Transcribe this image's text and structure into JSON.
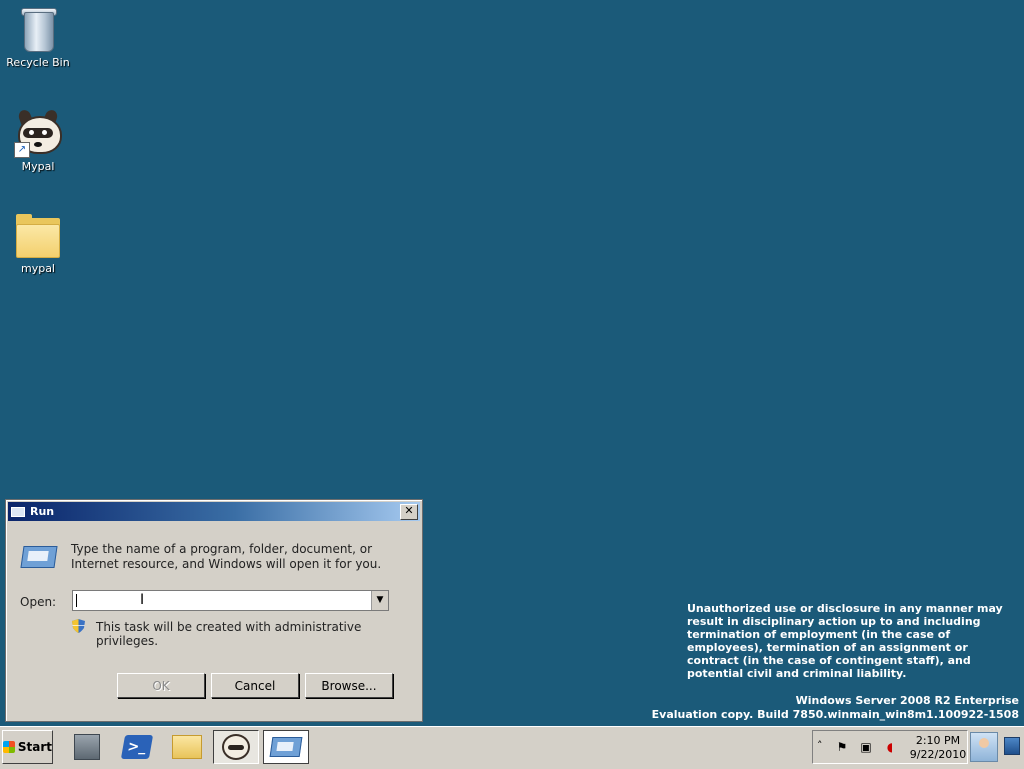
{
  "desktop": {
    "icons": [
      {
        "label": "Recycle Bin",
        "icon": "recycle-bin-icon"
      },
      {
        "label": "Mypal",
        "icon": "raccoon-icon"
      },
      {
        "label": "mypal",
        "icon": "folder-icon"
      }
    ],
    "background_color": "#1b5a79",
    "legal_notice": "Unauthorized use or disclosure in any manner may result in disciplinary action up to and including termination of employment (in the case of employees), termination of an assignment or contract (in the case of contingent staff), and potential civil and criminal liability.",
    "watermark": {
      "line1": "Windows Server 2008 R2 Enterprise",
      "line2": "Evaluation copy. Build 7850.winmain_win8m1.100922-1508"
    }
  },
  "run_dialog": {
    "title": "Run",
    "close_label": "✕",
    "description": "Type the name of a program, folder, document, or Internet resource, and Windows will open it for you.",
    "open_label": "Open:",
    "open_value": "",
    "admin_note": "This task will be created with administrative privileges.",
    "buttons": {
      "ok": "OK",
      "cancel": "Cancel",
      "browse": "Browse..."
    }
  },
  "taskbar": {
    "start_label": "Start",
    "pinned": [
      {
        "name": "server-manager",
        "icon": "server-manager-icon"
      },
      {
        "name": "powershell",
        "icon": "powershell-icon"
      },
      {
        "name": "explorer",
        "icon": "folder-explorer-icon"
      },
      {
        "name": "mypal",
        "icon": "raccoon-icon"
      },
      {
        "name": "run",
        "icon": "run-icon"
      }
    ],
    "tray": {
      "time": "2:10 PM",
      "date": "9/22/2010"
    }
  }
}
